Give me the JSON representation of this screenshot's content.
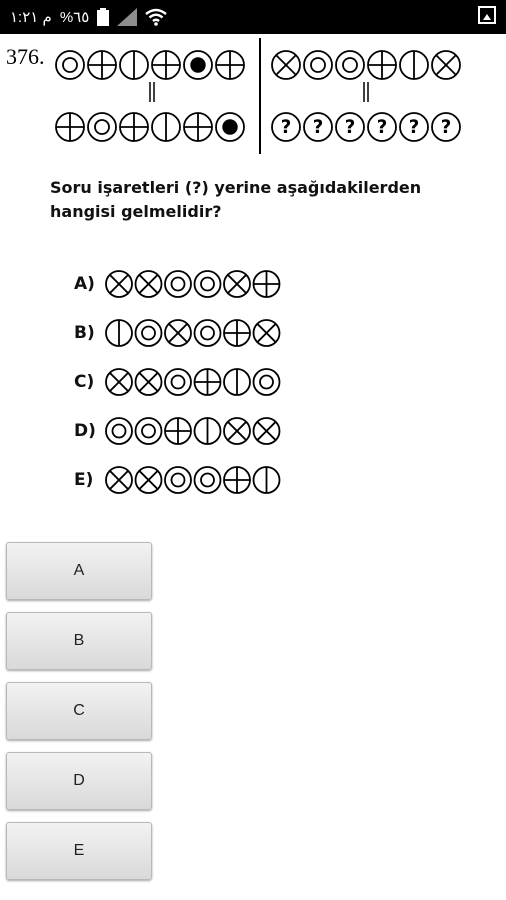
{
  "status_bar": {
    "time": "م ١:٢١",
    "battery": "%٦٥"
  },
  "question": {
    "number": "376.",
    "top_left_row": [
      "double-circle",
      "cross-circle",
      "vbar-circle",
      "cross-circle",
      "filled-circle",
      "cross-circle"
    ],
    "top_right_row": [
      "x-circle",
      "double-circle",
      "double-circle",
      "cross-circle",
      "vbar-circle",
      "x-circle"
    ],
    "bottom_left_row": [
      "cross-circle",
      "double-circle",
      "cross-circle",
      "vbar-circle",
      "cross-circle",
      "filled-circle"
    ],
    "bottom_right_row": [
      "question-circle",
      "question-circle",
      "question-circle",
      "question-circle",
      "question-circle",
      "question-circle"
    ],
    "text": "Soru işaretleri (?) yerine aşağıdakilerden hangisi gelmelidir?",
    "options": [
      {
        "label": "A)",
        "symbols": [
          "x-circle",
          "x-circle",
          "double-circle",
          "double-circle",
          "x-circle",
          "cross-circle"
        ]
      },
      {
        "label": "B)",
        "symbols": [
          "vbar-circle",
          "double-circle",
          "x-circle",
          "double-circle",
          "cross-circle",
          "x-circle"
        ]
      },
      {
        "label": "C)",
        "symbols": [
          "x-circle",
          "x-circle",
          "double-circle",
          "cross-circle",
          "vbar-circle",
          "double-circle"
        ]
      },
      {
        "label": "D)",
        "symbols": [
          "double-circle",
          "double-circle",
          "cross-circle",
          "vbar-circle",
          "x-circle",
          "x-circle"
        ]
      },
      {
        "label": "E)",
        "symbols": [
          "x-circle",
          "x-circle",
          "double-circle",
          "double-circle",
          "cross-circle",
          "vbar-circle"
        ]
      }
    ]
  },
  "answer_buttons": [
    "A",
    "B",
    "C",
    "D",
    "E"
  ]
}
